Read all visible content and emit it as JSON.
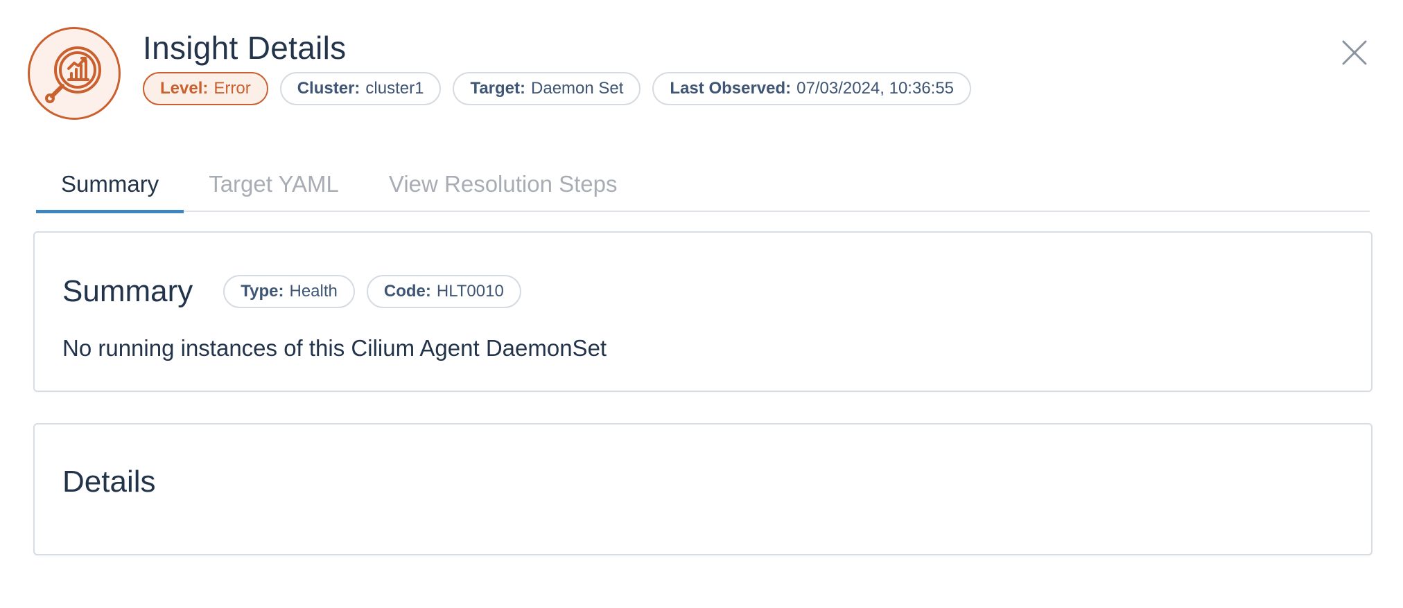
{
  "header": {
    "title": "Insight Details",
    "icon": "insight-chart-magnifier-icon",
    "tags": {
      "level": {
        "label": "Level:",
        "value": "Error"
      },
      "cluster": {
        "label": "Cluster:",
        "value": "cluster1"
      },
      "target": {
        "label": "Target:",
        "value": "Daemon Set"
      },
      "last_observed": {
        "label": "Last Observed:",
        "value": "07/03/2024, 10:36:55"
      }
    },
    "close_icon": "close-icon"
  },
  "tabs": [
    {
      "label": "Summary",
      "active": true
    },
    {
      "label": "Target YAML",
      "active": false
    },
    {
      "label": "View Resolution Steps",
      "active": false
    }
  ],
  "summary_card": {
    "title": "Summary",
    "type": {
      "label": "Type:",
      "value": "Health"
    },
    "code": {
      "label": "Code:",
      "value": "HLT0010"
    },
    "text": "No running instances of this Cilium Agent DaemonSet"
  },
  "details_card": {
    "title": "Details"
  },
  "colors": {
    "accent_orange": "#c9602e",
    "tab_active_underline": "#3f86c1",
    "text_dark": "#22334a",
    "text_muted": "#a8adb5"
  }
}
